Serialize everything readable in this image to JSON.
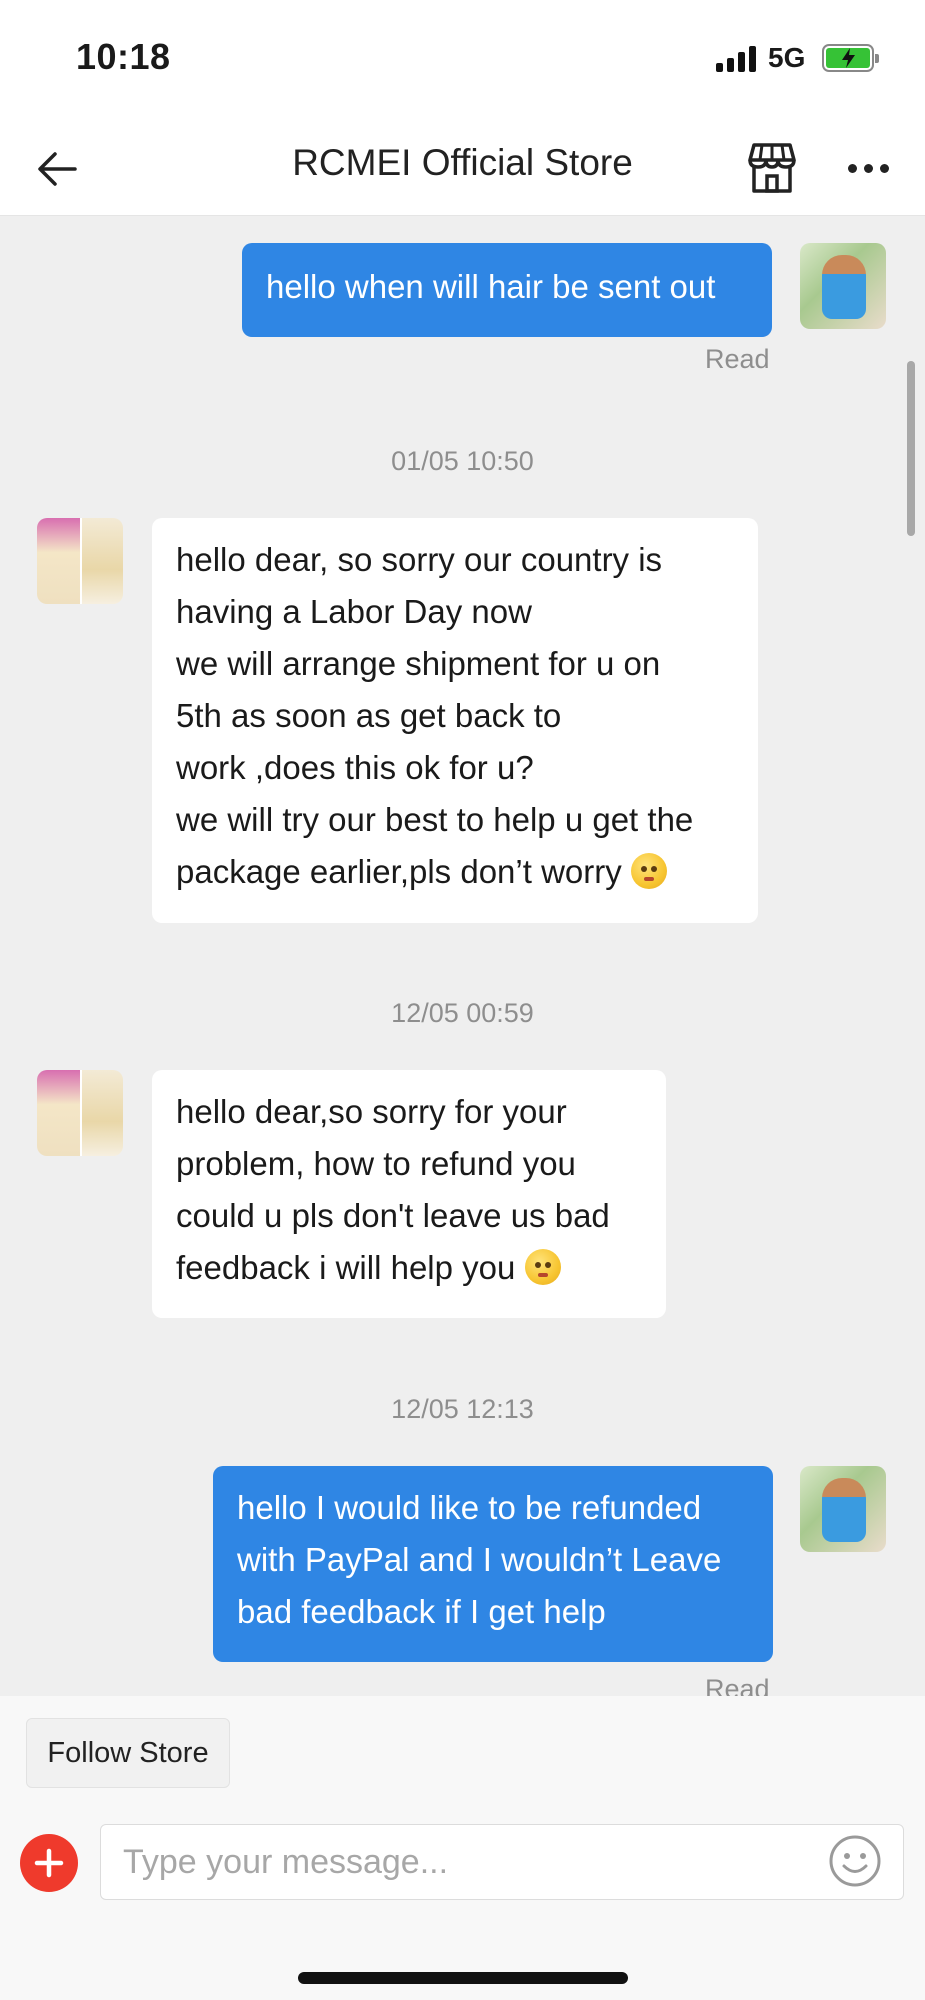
{
  "status_bar": {
    "time": "10:18",
    "network": "5G"
  },
  "header": {
    "title": "RCMEI Official Store"
  },
  "messages": [
    {
      "sender": "user",
      "lines": [
        "hello when will hair be sent out"
      ],
      "status": "Read"
    },
    {
      "timestamp": "01/05 10:50"
    },
    {
      "sender": "store",
      "lines": [
        "hello dear, so sorry our country is",
        "having a Labor Day now",
        "we will arrange shipment for u on",
        "5th as soon as get back to",
        "work ,does this ok for u?",
        "we will try our best to help u get the",
        "package earlier,pls don’t worry"
      ],
      "emoji": "hugging-face-emoji"
    },
    {
      "timestamp": "12/05 00:59"
    },
    {
      "sender": "store",
      "lines": [
        "hello dear,so sorry for your",
        "problem, how to refund you",
        "could u pls don't leave us bad",
        "feedback i will help you"
      ],
      "emoji": "pleading-face-emoji"
    },
    {
      "timestamp": "12/05 12:13"
    },
    {
      "sender": "user",
      "lines": [
        "hello I would like to be refunded",
        "with PayPal and I wouldn’t Leave",
        "bad feedback if I get help"
      ],
      "status": "Read"
    }
  ],
  "footer": {
    "follow_label": "Follow Store",
    "input_placeholder": "Type your message...",
    "input_value": ""
  },
  "colors": {
    "outgoing_bubble": "#2f86e4",
    "chat_background": "#efefef",
    "plus_button": "#ef3a2c"
  }
}
